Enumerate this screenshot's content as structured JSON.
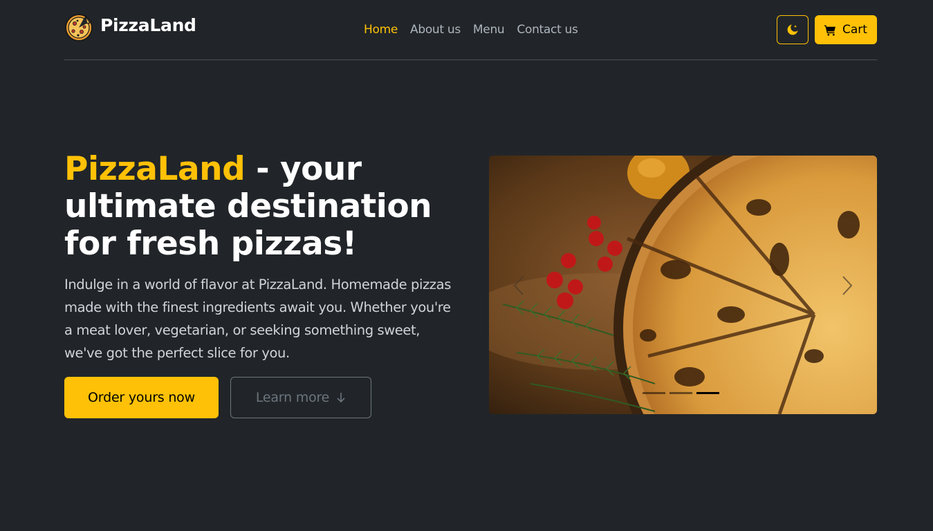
{
  "header": {
    "brand_name": "PizzaLand",
    "brand_icon": "pizza-logo-icon",
    "nav": [
      {
        "label": "Home",
        "active": true
      },
      {
        "label": "About us",
        "active": false
      },
      {
        "label": "Menu",
        "active": false
      },
      {
        "label": "Contact us",
        "active": false
      }
    ],
    "theme_icon": "moon-stars-icon",
    "cart_label": "Cart",
    "cart_icon": "cart-icon"
  },
  "hero": {
    "title_accent": "PizzaLand",
    "title_rest": " - your ultimate destination for fresh pizzas!",
    "description": "Indulge in a world of flavor at PizzaLand. Homemade pizzas made with the finest ingredients await you. Whether you're a meat lover, vegetarian, or seeking something sweet, we've got the perfect slice for you.",
    "order_button": "Order yours now",
    "learn_button": "Learn more",
    "learn_icon": "arrow-down-icon"
  },
  "carousel": {
    "prev_icon": "chevron-left-icon",
    "next_icon": "chevron-right-icon",
    "slide_count": 3,
    "active_slide": 3
  },
  "colors": {
    "accent": "#ffc107",
    "background": "#212529"
  }
}
